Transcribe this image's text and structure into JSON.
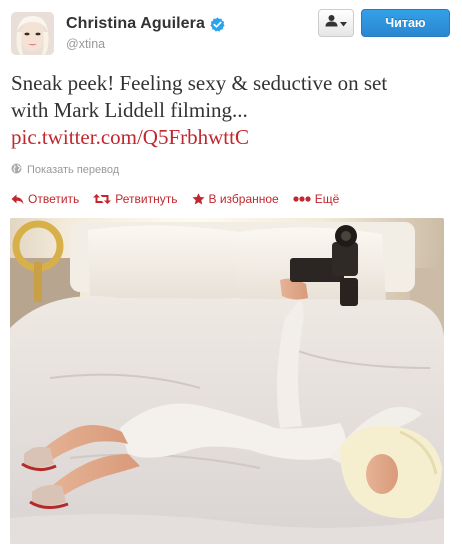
{
  "user": {
    "full_name": "Christina Aguilera",
    "handle": "@xtina"
  },
  "buttons": {
    "follow_label": "Читаю"
  },
  "tweet": {
    "text_line1": "Sneak peek! Feeling sexy & seductive on set",
    "text_line2": "with Mark Liddell filming...",
    "link_text": "pic.twitter.com/Q5FrbhwttC"
  },
  "translate_label": "Показать перевод",
  "actions": {
    "reply": "Ответить",
    "retweet": "Ретвитнуть",
    "favorite": "В избранное",
    "more": "Ещё"
  },
  "colors": {
    "accent": "#c1272d",
    "follow_button": "#2a87d1",
    "verified_badge": "#2aa3ef",
    "muted_text": "#999999"
  },
  "icons": [
    "verified-icon",
    "user-icon",
    "caret-down-icon",
    "globe-icon",
    "reply-icon",
    "retweet-icon",
    "star-icon",
    "more-dots-icon"
  ]
}
